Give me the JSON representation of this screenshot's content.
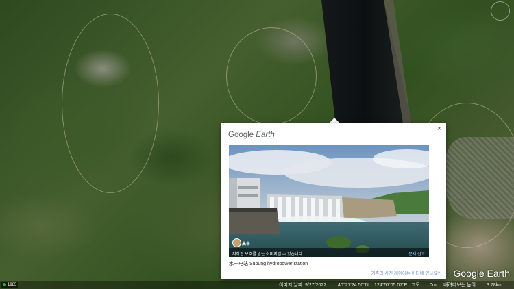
{
  "popup": {
    "brand_google": "Google",
    "brand_earth": "Earth",
    "close_label": "×",
    "photo": {
      "author": "高丰",
      "rights_notice": "저작권 보호를 받는 이미지일 수 있습니다.",
      "report_label": "문제 신고"
    },
    "caption": "水丰电站 Supung hydropower station",
    "location_link": "기존의 사진 레이어는 어디에 있나요?"
  },
  "watermark": "Google Earth",
  "status_bar": {
    "image_date": "이미지 날짜: 9/27/2022",
    "latitude": "40°27'24.50\"N",
    "longitude": "124°57'05.07\"E",
    "elevation": "고도:",
    "elevation_value": "0m",
    "camera": "내려다보는 높이:",
    "camera_value": "3.78km"
  },
  "corner_badge": "1985"
}
